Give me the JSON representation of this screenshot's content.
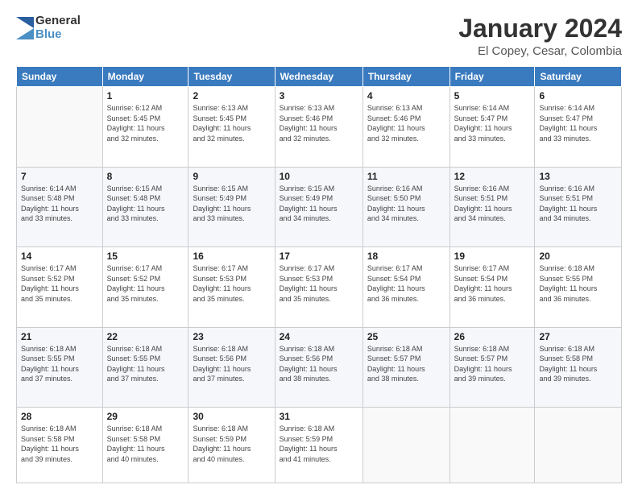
{
  "logo": {
    "general": "General",
    "blue": "Blue"
  },
  "header": {
    "title": "January 2024",
    "subtitle": "El Copey, Cesar, Colombia"
  },
  "weekdays": [
    "Sunday",
    "Monday",
    "Tuesday",
    "Wednesday",
    "Thursday",
    "Friday",
    "Saturday"
  ],
  "weeks": [
    [
      {
        "day": "",
        "info": ""
      },
      {
        "day": "1",
        "info": "Sunrise: 6:12 AM\nSunset: 5:45 PM\nDaylight: 11 hours\nand 32 minutes."
      },
      {
        "day": "2",
        "info": "Sunrise: 6:13 AM\nSunset: 5:45 PM\nDaylight: 11 hours\nand 32 minutes."
      },
      {
        "day": "3",
        "info": "Sunrise: 6:13 AM\nSunset: 5:46 PM\nDaylight: 11 hours\nand 32 minutes."
      },
      {
        "day": "4",
        "info": "Sunrise: 6:13 AM\nSunset: 5:46 PM\nDaylight: 11 hours\nand 32 minutes."
      },
      {
        "day": "5",
        "info": "Sunrise: 6:14 AM\nSunset: 5:47 PM\nDaylight: 11 hours\nand 33 minutes."
      },
      {
        "day": "6",
        "info": "Sunrise: 6:14 AM\nSunset: 5:47 PM\nDaylight: 11 hours\nand 33 minutes."
      }
    ],
    [
      {
        "day": "7",
        "info": "Sunrise: 6:14 AM\nSunset: 5:48 PM\nDaylight: 11 hours\nand 33 minutes."
      },
      {
        "day": "8",
        "info": "Sunrise: 6:15 AM\nSunset: 5:48 PM\nDaylight: 11 hours\nand 33 minutes."
      },
      {
        "day": "9",
        "info": "Sunrise: 6:15 AM\nSunset: 5:49 PM\nDaylight: 11 hours\nand 33 minutes."
      },
      {
        "day": "10",
        "info": "Sunrise: 6:15 AM\nSunset: 5:49 PM\nDaylight: 11 hours\nand 34 minutes."
      },
      {
        "day": "11",
        "info": "Sunrise: 6:16 AM\nSunset: 5:50 PM\nDaylight: 11 hours\nand 34 minutes."
      },
      {
        "day": "12",
        "info": "Sunrise: 6:16 AM\nSunset: 5:51 PM\nDaylight: 11 hours\nand 34 minutes."
      },
      {
        "day": "13",
        "info": "Sunrise: 6:16 AM\nSunset: 5:51 PM\nDaylight: 11 hours\nand 34 minutes."
      }
    ],
    [
      {
        "day": "14",
        "info": "Sunrise: 6:17 AM\nSunset: 5:52 PM\nDaylight: 11 hours\nand 35 minutes."
      },
      {
        "day": "15",
        "info": "Sunrise: 6:17 AM\nSunset: 5:52 PM\nDaylight: 11 hours\nand 35 minutes."
      },
      {
        "day": "16",
        "info": "Sunrise: 6:17 AM\nSunset: 5:53 PM\nDaylight: 11 hours\nand 35 minutes."
      },
      {
        "day": "17",
        "info": "Sunrise: 6:17 AM\nSunset: 5:53 PM\nDaylight: 11 hours\nand 35 minutes."
      },
      {
        "day": "18",
        "info": "Sunrise: 6:17 AM\nSunset: 5:54 PM\nDaylight: 11 hours\nand 36 minutes."
      },
      {
        "day": "19",
        "info": "Sunrise: 6:17 AM\nSunset: 5:54 PM\nDaylight: 11 hours\nand 36 minutes."
      },
      {
        "day": "20",
        "info": "Sunrise: 6:18 AM\nSunset: 5:55 PM\nDaylight: 11 hours\nand 36 minutes."
      }
    ],
    [
      {
        "day": "21",
        "info": "Sunrise: 6:18 AM\nSunset: 5:55 PM\nDaylight: 11 hours\nand 37 minutes."
      },
      {
        "day": "22",
        "info": "Sunrise: 6:18 AM\nSunset: 5:55 PM\nDaylight: 11 hours\nand 37 minutes."
      },
      {
        "day": "23",
        "info": "Sunrise: 6:18 AM\nSunset: 5:56 PM\nDaylight: 11 hours\nand 37 minutes."
      },
      {
        "day": "24",
        "info": "Sunrise: 6:18 AM\nSunset: 5:56 PM\nDaylight: 11 hours\nand 38 minutes."
      },
      {
        "day": "25",
        "info": "Sunrise: 6:18 AM\nSunset: 5:57 PM\nDaylight: 11 hours\nand 38 minutes."
      },
      {
        "day": "26",
        "info": "Sunrise: 6:18 AM\nSunset: 5:57 PM\nDaylight: 11 hours\nand 39 minutes."
      },
      {
        "day": "27",
        "info": "Sunrise: 6:18 AM\nSunset: 5:58 PM\nDaylight: 11 hours\nand 39 minutes."
      }
    ],
    [
      {
        "day": "28",
        "info": "Sunrise: 6:18 AM\nSunset: 5:58 PM\nDaylight: 11 hours\nand 39 minutes."
      },
      {
        "day": "29",
        "info": "Sunrise: 6:18 AM\nSunset: 5:58 PM\nDaylight: 11 hours\nand 40 minutes."
      },
      {
        "day": "30",
        "info": "Sunrise: 6:18 AM\nSunset: 5:59 PM\nDaylight: 11 hours\nand 40 minutes."
      },
      {
        "day": "31",
        "info": "Sunrise: 6:18 AM\nSunset: 5:59 PM\nDaylight: 11 hours\nand 41 minutes."
      },
      {
        "day": "",
        "info": ""
      },
      {
        "day": "",
        "info": ""
      },
      {
        "day": "",
        "info": ""
      }
    ]
  ]
}
